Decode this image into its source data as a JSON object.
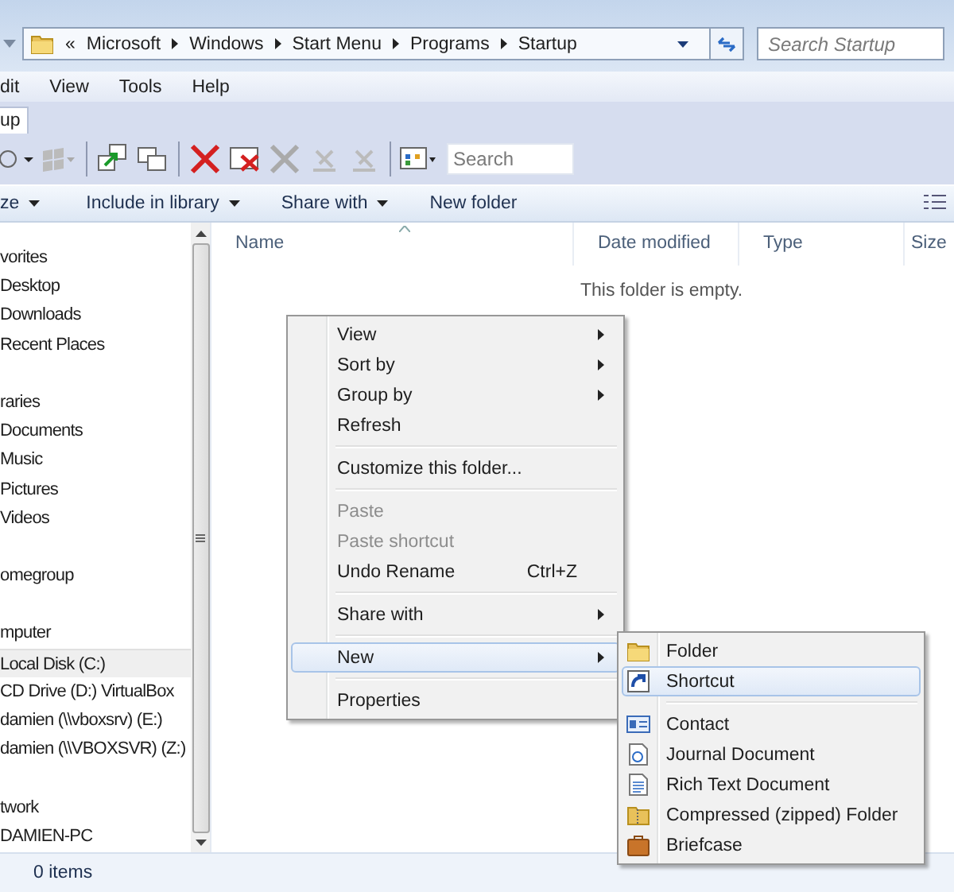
{
  "address_bar": {
    "prefix": "«",
    "crumbs": [
      "Microsoft",
      "Windows",
      "Start Menu",
      "Programs",
      "Startup"
    ]
  },
  "search": {
    "placeholder": "Search Startup"
  },
  "menu_bar": [
    "dit",
    "View",
    "Tools",
    "Help"
  ],
  "tabs": [
    {
      "label": "up",
      "selected": true
    }
  ],
  "toolbar": {
    "search_placeholder": "Search"
  },
  "command_bar": [
    {
      "label": "ze",
      "dropdown": true
    },
    {
      "label": "Include in library",
      "dropdown": true
    },
    {
      "label": "Share with",
      "dropdown": true
    },
    {
      "label": "New folder",
      "dropdown": false
    }
  ],
  "navigation": [
    {
      "label": "vorites",
      "selected": false,
      "children": [
        {
          "label": "Desktop",
          "selected": false
        },
        {
          "label": "Downloads",
          "selected": false
        },
        {
          "label": "Recent Places",
          "selected": false
        }
      ]
    },
    {
      "label": "raries",
      "selected": false,
      "children": [
        {
          "label": "Documents",
          "selected": false
        },
        {
          "label": "Music",
          "selected": false
        },
        {
          "label": "Pictures",
          "selected": false
        },
        {
          "label": "Videos",
          "selected": false
        }
      ]
    },
    {
      "label": "omegroup",
      "selected": false
    },
    {
      "label": "mputer",
      "selected": false,
      "children": [
        {
          "label": "Local Disk (C:)",
          "selected": true
        },
        {
          "label": "CD Drive (D:) VirtualBox",
          "selected": false
        },
        {
          "label": "damien (\\\\vboxsrv) (E:)",
          "selected": false
        },
        {
          "label": "damien (\\\\VBOXSVR) (Z:)",
          "selected": false
        }
      ]
    },
    {
      "label": "twork",
      "selected": false,
      "children": [
        {
          "label": "DAMIEN-PC",
          "selected": false
        }
      ]
    }
  ],
  "columns": [
    "Name",
    "Date modified",
    "Type",
    "Size"
  ],
  "empty_message": "This folder is empty.",
  "context_menu": [
    {
      "kind": "item",
      "label": "View",
      "submenu": true,
      "disabled": false,
      "selected": false
    },
    {
      "kind": "item",
      "label": "Sort by",
      "submenu": true,
      "disabled": false,
      "selected": false
    },
    {
      "kind": "item",
      "label": "Group by",
      "submenu": true,
      "disabled": false,
      "selected": false
    },
    {
      "kind": "item",
      "label": "Refresh",
      "submenu": false,
      "disabled": false,
      "selected": false
    },
    {
      "kind": "separator"
    },
    {
      "kind": "item",
      "label": "Customize this folder...",
      "submenu": false,
      "disabled": false,
      "selected": false
    },
    {
      "kind": "separator"
    },
    {
      "kind": "item",
      "label": "Paste",
      "submenu": false,
      "disabled": true,
      "selected": false
    },
    {
      "kind": "item",
      "label": "Paste shortcut",
      "submenu": false,
      "disabled": true,
      "selected": false
    },
    {
      "kind": "item",
      "label": "Undo Rename",
      "shortcut": "Ctrl+Z",
      "submenu": false,
      "disabled": false,
      "selected": false
    },
    {
      "kind": "separator"
    },
    {
      "kind": "item",
      "label": "Share with",
      "submenu": true,
      "disabled": false,
      "selected": false
    },
    {
      "kind": "separator"
    },
    {
      "kind": "item",
      "label": "New",
      "submenu": true,
      "disabled": false,
      "selected": true
    },
    {
      "kind": "separator"
    },
    {
      "kind": "item",
      "label": "Properties",
      "submenu": false,
      "disabled": false,
      "selected": false
    }
  ],
  "new_submenu": [
    {
      "kind": "folder",
      "label": "Folder",
      "selected": false
    },
    {
      "kind": "shortcut",
      "label": "Shortcut",
      "selected": true
    },
    {
      "kind": "separator"
    },
    {
      "kind": "contact",
      "label": "Contact",
      "selected": false
    },
    {
      "kind": "journal",
      "label": "Journal Document",
      "selected": false
    },
    {
      "kind": "document",
      "label": "Rich Text Document",
      "selected": false
    },
    {
      "kind": "zip",
      "label": "Compressed (zipped) Folder",
      "selected": false
    },
    {
      "kind": "briefcase",
      "label": "Briefcase",
      "selected": false
    }
  ],
  "status_bar": {
    "item_count": "0 items"
  }
}
